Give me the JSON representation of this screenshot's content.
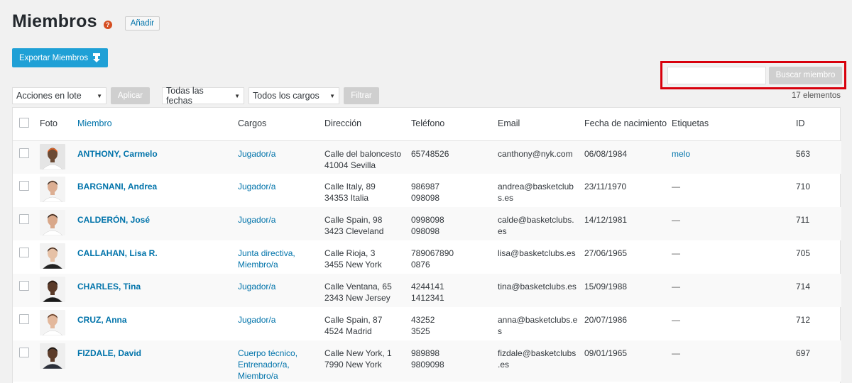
{
  "header": {
    "title": "Miembros",
    "help_glyph": "?",
    "add_label": "Añadir"
  },
  "export_label": "Exportar Miembros",
  "search": {
    "value": "",
    "placeholder": "",
    "button_label": "Buscar miembro"
  },
  "filters": {
    "bulk_actions": "Acciones en lote",
    "apply_label": "Aplicar",
    "dates": "Todas las fechas",
    "roles": "Todos los cargos",
    "filter_label": "Filtrar"
  },
  "items_count": "17 elementos",
  "table": {
    "columns": {
      "photo": "Foto",
      "member": "Miembro",
      "roles": "Cargos",
      "address": "Dirección",
      "phone": "Teléfono",
      "email": "Email",
      "birth_date": "Fecha de nacimiento",
      "tags": "Etiquetas",
      "id": "ID"
    },
    "rows": [
      {
        "name": "ANTHONY, Carmelo",
        "roles": [
          "Jugador/a"
        ],
        "address": [
          "Calle del baloncesto",
          "41004 Sevilla"
        ],
        "phone": [
          "65748526"
        ],
        "email": [
          "canthony@nyk.com"
        ],
        "birth": "06/08/1984",
        "tags": "melo",
        "id": "563",
        "photo": {
          "bg": "#e5e5e5",
          "skin": "#6b4a34",
          "shirt": "#ffffff",
          "accent": "#f26522"
        }
      },
      {
        "name": "BARGNANI, Andrea",
        "roles": [
          "Jugador/a"
        ],
        "address": [
          "Calle Italy, 89",
          "34353 Italia"
        ],
        "phone": [
          "986987",
          "098098"
        ],
        "email": [
          "andrea@basketclub",
          "s.es"
        ],
        "birth": "23/11/1970",
        "tags": "—",
        "id": "710",
        "photo": {
          "bg": "#f4f4f4",
          "skin": "#dcae92",
          "shirt": "#ffffff",
          "accent": "#3a2a20"
        }
      },
      {
        "name": "CALDERÓN, José",
        "roles": [
          "Jugador/a"
        ],
        "address": [
          "Calle Spain, 98",
          "3423 Cleveland"
        ],
        "phone": [
          "0998098",
          "098098"
        ],
        "email": [
          "calde@basketclubs.",
          "es"
        ],
        "birth": "14/12/1981",
        "tags": "—",
        "id": "711",
        "photo": {
          "bg": "#f4f4f4",
          "skin": "#d9a88a",
          "shirt": "#ffffff",
          "accent": "#2a1c14"
        }
      },
      {
        "name": "CALLAHAN, Lisa R.",
        "roles": [
          "Junta directiva,",
          "Miembro/a"
        ],
        "address": [
          "Calle Rioja, 3",
          "3455 New York"
        ],
        "phone": [
          "789067890",
          "0876"
        ],
        "email": [
          "lisa@basketclubs.es"
        ],
        "birth": "27/06/1965",
        "tags": "—",
        "id": "705",
        "photo": {
          "bg": "#f2f2f2",
          "skin": "#e6c1a6",
          "shirt": "#222222",
          "accent": "#3b2417"
        }
      },
      {
        "name": "CHARLES, Tina",
        "roles": [
          "Jugador/a"
        ],
        "address": [
          "Calle Ventana, 65",
          "2343 New Jersey"
        ],
        "phone": [
          "4244141",
          "1412341"
        ],
        "email": [
          "tina@basketclubs.es"
        ],
        "birth": "15/09/1988",
        "tags": "—",
        "id": "714",
        "photo": {
          "bg": "#f2f2f2",
          "skin": "#5a3a28",
          "shirt": "#1a1a1a",
          "accent": "#1e120c"
        }
      },
      {
        "name": "CRUZ, Anna",
        "roles": [
          "Jugador/a"
        ],
        "address": [
          "Calle Spain, 87",
          "4524 Madrid"
        ],
        "phone": [
          "43252",
          "3525"
        ],
        "email": [
          "anna@basketclubs.e",
          "s"
        ],
        "birth": "20/07/1986",
        "tags": "—",
        "id": "712",
        "photo": {
          "bg": "#f4f4f4",
          "skin": "#e3b89c",
          "shirt": "#ffffff",
          "accent": "#5a3520"
        }
      },
      {
        "name": "FIZDALE, David",
        "roles": [
          "Cuerpo técnico,",
          "Entrenador/a,",
          "Miembro/a"
        ],
        "address": [
          "Calle New York, 1",
          "7990 New York"
        ],
        "phone": [
          "989898",
          "9809098"
        ],
        "email": [
          "fizdale@basketclubs",
          ".es"
        ],
        "birth": "09/01/1965",
        "tags": "—",
        "id": "697",
        "photo": {
          "bg": "#eeeeee",
          "skin": "#5c3c2a",
          "shirt": "#2b2f3a",
          "accent": "#111111"
        }
      }
    ]
  }
}
